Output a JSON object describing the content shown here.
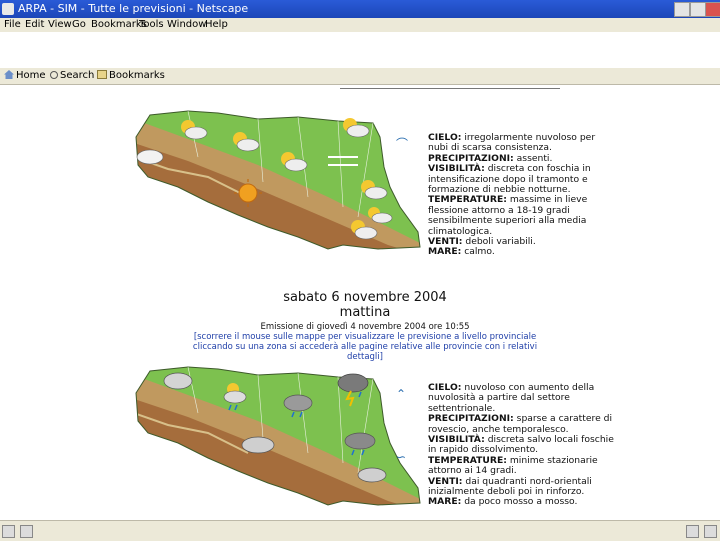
{
  "window": {
    "title": "ARPA - SIM - Tutte le previsioni - Netscape"
  },
  "menu": [
    "File",
    "Edit",
    "View",
    "Go",
    "Bookmarks",
    "Tools",
    "Window",
    "Help"
  ],
  "navbar": {
    "home_label": "Home",
    "search_label": "Search",
    "bookmarks_label": "Bookmarks"
  },
  "forecast1": {
    "cielo_label": "CIELO:",
    "cielo_text": "irregolarmente nuvoloso per nubi di scarsa consistenza.",
    "precip_label": "PRECIPITAZIONI:",
    "precip_text": "assenti.",
    "visib_label": "VISIBILITÀ:",
    "visib_text": "discreta con foschia in intensificazione dopo il tramonto e formazione di nebbie notturne.",
    "temp_label": "TEMPERATURE:",
    "temp_text": "massime in lieve flessione attorno a 18-19 gradi sensibilmente superiori alla media climatologica.",
    "venti_label": "VENTI:",
    "venti_text": "deboli variabili.",
    "mare_label": "MARE:",
    "mare_text": "calmo."
  },
  "day2": {
    "date": "sabato 6 novembre 2004",
    "period": "mattina",
    "emission": "Emissione di giovedì 4 novembre 2004 ore 10:55",
    "hint1": "[scorrere il mouse sulle mappe per visualizzare le previsione a livello provinciale",
    "hint2": "cliccando su una zona si accederà alle pagine relative alle provincie con i relativi dettagli]"
  },
  "forecast2": {
    "cielo_label": "CIELO:",
    "cielo_text": "nuvoloso con aumento della nuvolosità a partire dal settore settentrionale.",
    "precip_label": "PRECIPITAZIONI:",
    "precip_text": "sparse a carattere di rovescio, anche temporalesco.",
    "visib_label": "VISIBILITÀ:",
    "visib_text": "discreta salvo locali foschie in rapido dissolvimento.",
    "temp_label": "TEMPERATURE:",
    "temp_text": "minime stazionarie attorno ai 14 gradi.",
    "venti_label": "VENTI:",
    "venti_text": "dai quadranti nord-orientali inizialmente deboli poi in rinforzo.",
    "mare_label": "MARE:",
    "mare_text": "da poco mosso a mosso."
  },
  "colors": {
    "titlebar": "#2a5bd7",
    "chrome": "#ece9d8",
    "plain": "#7dc14f",
    "hills": "#c0995f",
    "mountains": "#a56d3c",
    "sea_symbol": "#2c6fb0",
    "hint_text": "#1f3fa8"
  },
  "map1_icons": [
    "partly-cloudy",
    "partly-cloudy",
    "partly-cloudy",
    "partly-cloudy",
    "sunny",
    "cloud",
    "fog",
    "partly-cloudy",
    "partly-cloudy",
    "partly-cloudy"
  ],
  "map2_icons": [
    "cloud",
    "partly-cloudy-rain",
    "cloud-rain",
    "thunderstorm",
    "cloud",
    "cloud-rain",
    "cloud"
  ]
}
